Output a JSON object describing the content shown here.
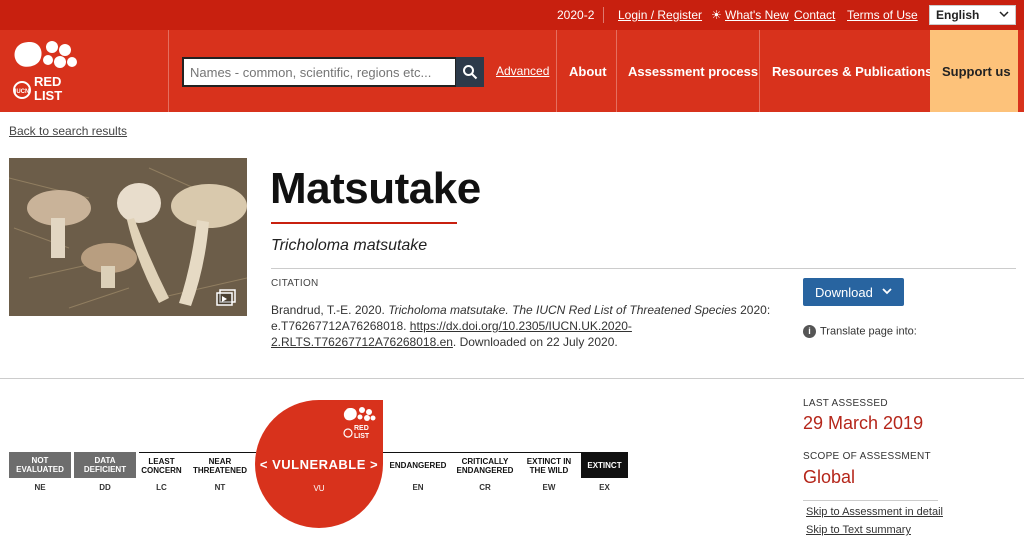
{
  "topbar": {
    "version": "2020-2",
    "login": "Login / Register",
    "whats_new": "What's New",
    "contact": "Contact",
    "terms": "Terms of Use",
    "language": "English"
  },
  "header": {
    "logo_text": "RED LIST",
    "search_placeholder": "Names - common, scientific, regions etc...",
    "advanced": "Advanced",
    "nav": [
      "About",
      "Assessment process",
      "Resources & Publications",
      "Support us"
    ]
  },
  "back_link": "Back to search results",
  "species": {
    "common_name": "Matsutake",
    "scientific_name": "Tricholoma matsutake",
    "citation_label": "CITATION",
    "citation_author": "Brandrud, T.-E. 2020. ",
    "citation_italic": "Tricholoma matsutake. The IUCN Red List of Threatened Species",
    "citation_mid": " 2020: e.T76267712A76268018. ",
    "citation_link": "https://dx.doi.org/10.2305/IUCN.UK.2020-2.RLTS.T76267712A76268018.en",
    "citation_end": ". Downloaded on 22 July 2020."
  },
  "actions": {
    "download": "Download",
    "translate": "Translate page into:"
  },
  "categories": [
    {
      "label": "NOT EVALUATED",
      "code": "NE",
      "bg": "#6d6d6d",
      "fg": "#ffffff"
    },
    {
      "label": "DATA DEFICIENT",
      "code": "DD",
      "bg": "#6d6d6d",
      "fg": "#ffffff"
    },
    {
      "label": "LEAST CONCERN",
      "code": "LC",
      "bg": "#ffffff",
      "fg": "#111111"
    },
    {
      "label": "NEAR THREATENED",
      "code": "NT",
      "bg": "#ffffff",
      "fg": "#111111"
    },
    {
      "label": "VULNERABLE",
      "code": "VU",
      "bg": "#d8321c",
      "fg": "#ffffff"
    },
    {
      "label": "ENDANGERED",
      "code": "EN",
      "bg": "#ffffff",
      "fg": "#111111"
    },
    {
      "label": "CRITICALLY ENDANGERED",
      "code": "CR",
      "bg": "#ffffff",
      "fg": "#111111"
    },
    {
      "label": "EXTINCT IN THE WILD",
      "code": "EW",
      "bg": "#ffffff",
      "fg": "#111111"
    },
    {
      "label": "EXTINCT",
      "code": "EX",
      "bg": "#111111",
      "fg": "#ffffff"
    }
  ],
  "current_category": "VU",
  "assessment": {
    "last_assessed_label": "LAST ASSESSED",
    "last_assessed_value": "29 March 2019",
    "scope_label": "SCOPE OF ASSESSMENT",
    "scope_value": "Global",
    "skip_detail": "Skip to Assessment in detail",
    "skip_summary": "Skip to Text summary"
  },
  "colors": {
    "topbar": "#c8200f",
    "header": "#d8321c",
    "support": "#fdc27a",
    "download": "#2864a0",
    "accent_text": "#b5261a"
  },
  "icons": [
    "search-icon",
    "sun-icon",
    "chevron-down-icon",
    "gallery-icon",
    "info-icon"
  ]
}
